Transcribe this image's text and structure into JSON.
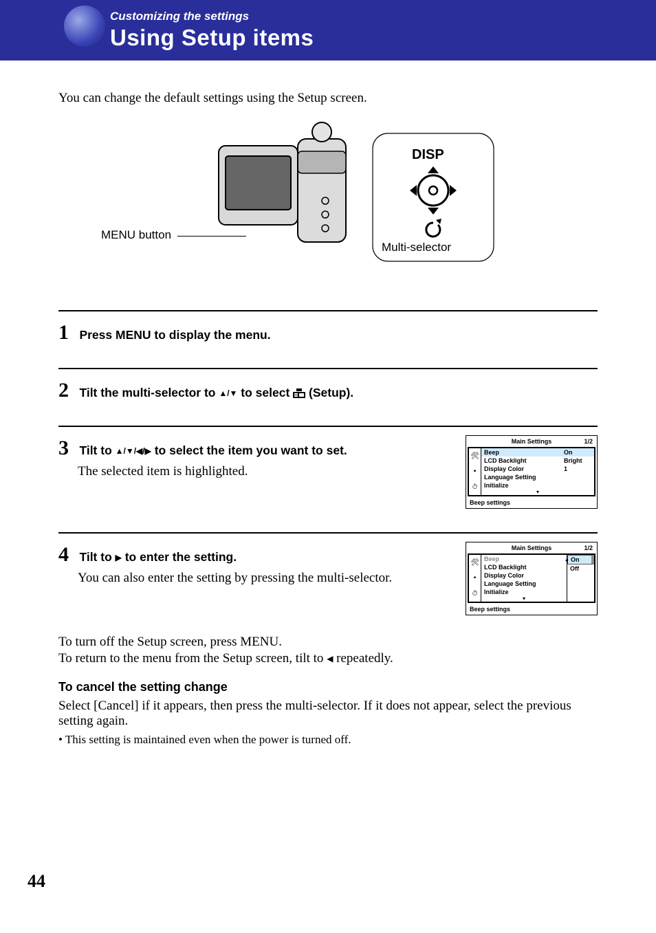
{
  "header": {
    "section": "Customizing the settings",
    "title": "Using Setup items"
  },
  "intro": "You can change the default settings using the Setup screen.",
  "diagram": {
    "menu_button_label": "MENU button",
    "disp_label": "DISP",
    "multi_selector_label": "Multi-selector"
  },
  "steps": [
    {
      "num": "1",
      "text_parts": [
        "Press MENU to display the menu."
      ]
    },
    {
      "num": "2",
      "text_before": "Tilt the multi-selector to ",
      "dir1": "▲/▼",
      "text_mid": " to select ",
      "text_after": " (Setup)."
    },
    {
      "num": "3",
      "text_before": "Tilt to ",
      "dirs": "▲/▼/◀/▶",
      "text_after": " to select the item you want to set.",
      "sub": "The selected item is highlighted."
    },
    {
      "num": "4",
      "text_before": "Tilt to ",
      "dir": "▶",
      "text_after": " to enter the setting.",
      "sub": "You can also enter the setting by pressing the multi-selector."
    }
  ],
  "screen3": {
    "title": "Main Settings",
    "page": "1/2",
    "rows": [
      {
        "k": "Beep",
        "v": "On",
        "selected": true
      },
      {
        "k": "LCD Backlight",
        "v": "Bright"
      },
      {
        "k": "Display Color",
        "v": "1"
      },
      {
        "k": "Language Setting",
        "v": ""
      },
      {
        "k": "Initialize",
        "v": ""
      }
    ],
    "footer": "Beep settings"
  },
  "screen4": {
    "title": "Main Settings",
    "page": "1/2",
    "rows": [
      {
        "k": "Beep"
      },
      {
        "k": "LCD Backlight"
      },
      {
        "k": "Display Color"
      },
      {
        "k": "Language Setting"
      },
      {
        "k": "Initialize"
      }
    ],
    "options": [
      {
        "label": "On",
        "selected": true
      },
      {
        "label": "Off"
      }
    ],
    "footer": "Beep settings"
  },
  "closing": {
    "p1": "To turn off the Setup screen, press MENU.",
    "p2_before": "To return to the menu from the Setup screen, tilt to ",
    "p2_dir": "◀",
    "p2_after": " repeatedly.",
    "cancel_head": "To cancel the setting change",
    "cancel_body": "Select [Cancel] if it appears, then press the multi-selector. If it does not appear, select the previous setting again.",
    "bullet": "• This setting is maintained even when the power is turned off."
  },
  "page_number": "44"
}
